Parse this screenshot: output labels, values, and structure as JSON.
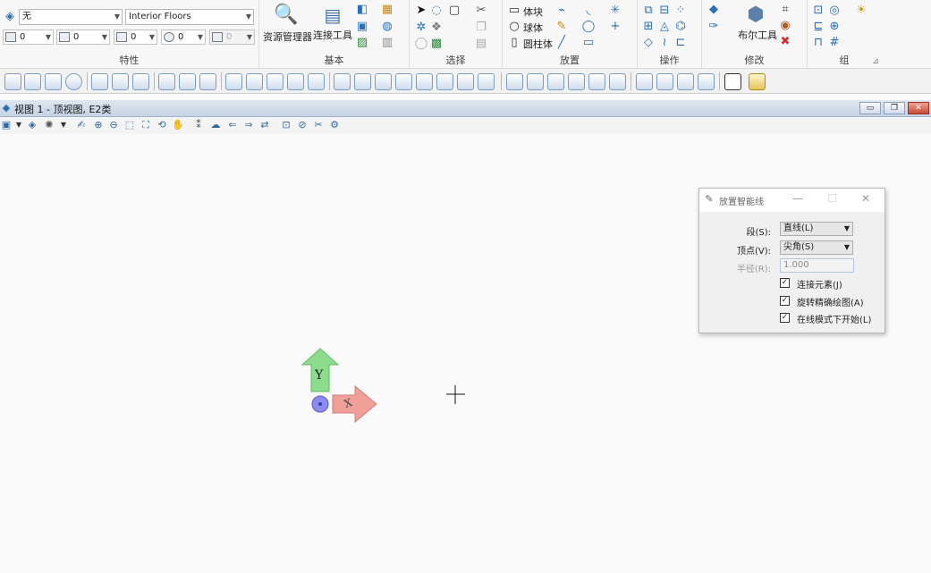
{
  "ribbon": {
    "attr_combo_level": "无",
    "attr_combo_style": "Interior Floors",
    "attr_small_values": [
      "0",
      "0",
      "0",
      "0",
      "0"
    ],
    "groups": {
      "attributes": "特性",
      "basic": "基本",
      "select": "选择",
      "place": "放置",
      "manipulate": "操作",
      "modify": "修改",
      "group": "组"
    },
    "basic": {
      "explorer_label": "资源管理器",
      "connect_label": "连接工具"
    },
    "place": {
      "block": "体块",
      "sphere": "球体",
      "cylinder": "圆柱体"
    },
    "modify": {
      "boolean_label": "布尔工具"
    },
    "launcher_glyph": "⊿"
  },
  "view": {
    "title": "视图 1 - 顶视图, E2类",
    "min_glyph": "▭",
    "restore_glyph": "❐",
    "close_glyph": "✕"
  },
  "dialog": {
    "title": "放置智能线",
    "segment_label": "段(S):",
    "segment_value": "直线(L)",
    "vertex_label": "顶点(V):",
    "vertex_value": "尖角(S)",
    "radius_label": "半径(R):",
    "radius_value": "1.000",
    "cb1": "连接元素(J)",
    "cb2": "旋转精确绘图(A)",
    "cb3": "在线模式下开始(L)",
    "check_glyph": "✓",
    "minimize_glyph": "—",
    "maximize_glyph": "☐",
    "close_glyph": "✕"
  },
  "axes": {
    "y_label": "Y",
    "x_label": "X"
  },
  "colors": {
    "y_axis": "#6fcf70",
    "x_axis": "#e8918a",
    "origin": "#7a7ae8"
  }
}
